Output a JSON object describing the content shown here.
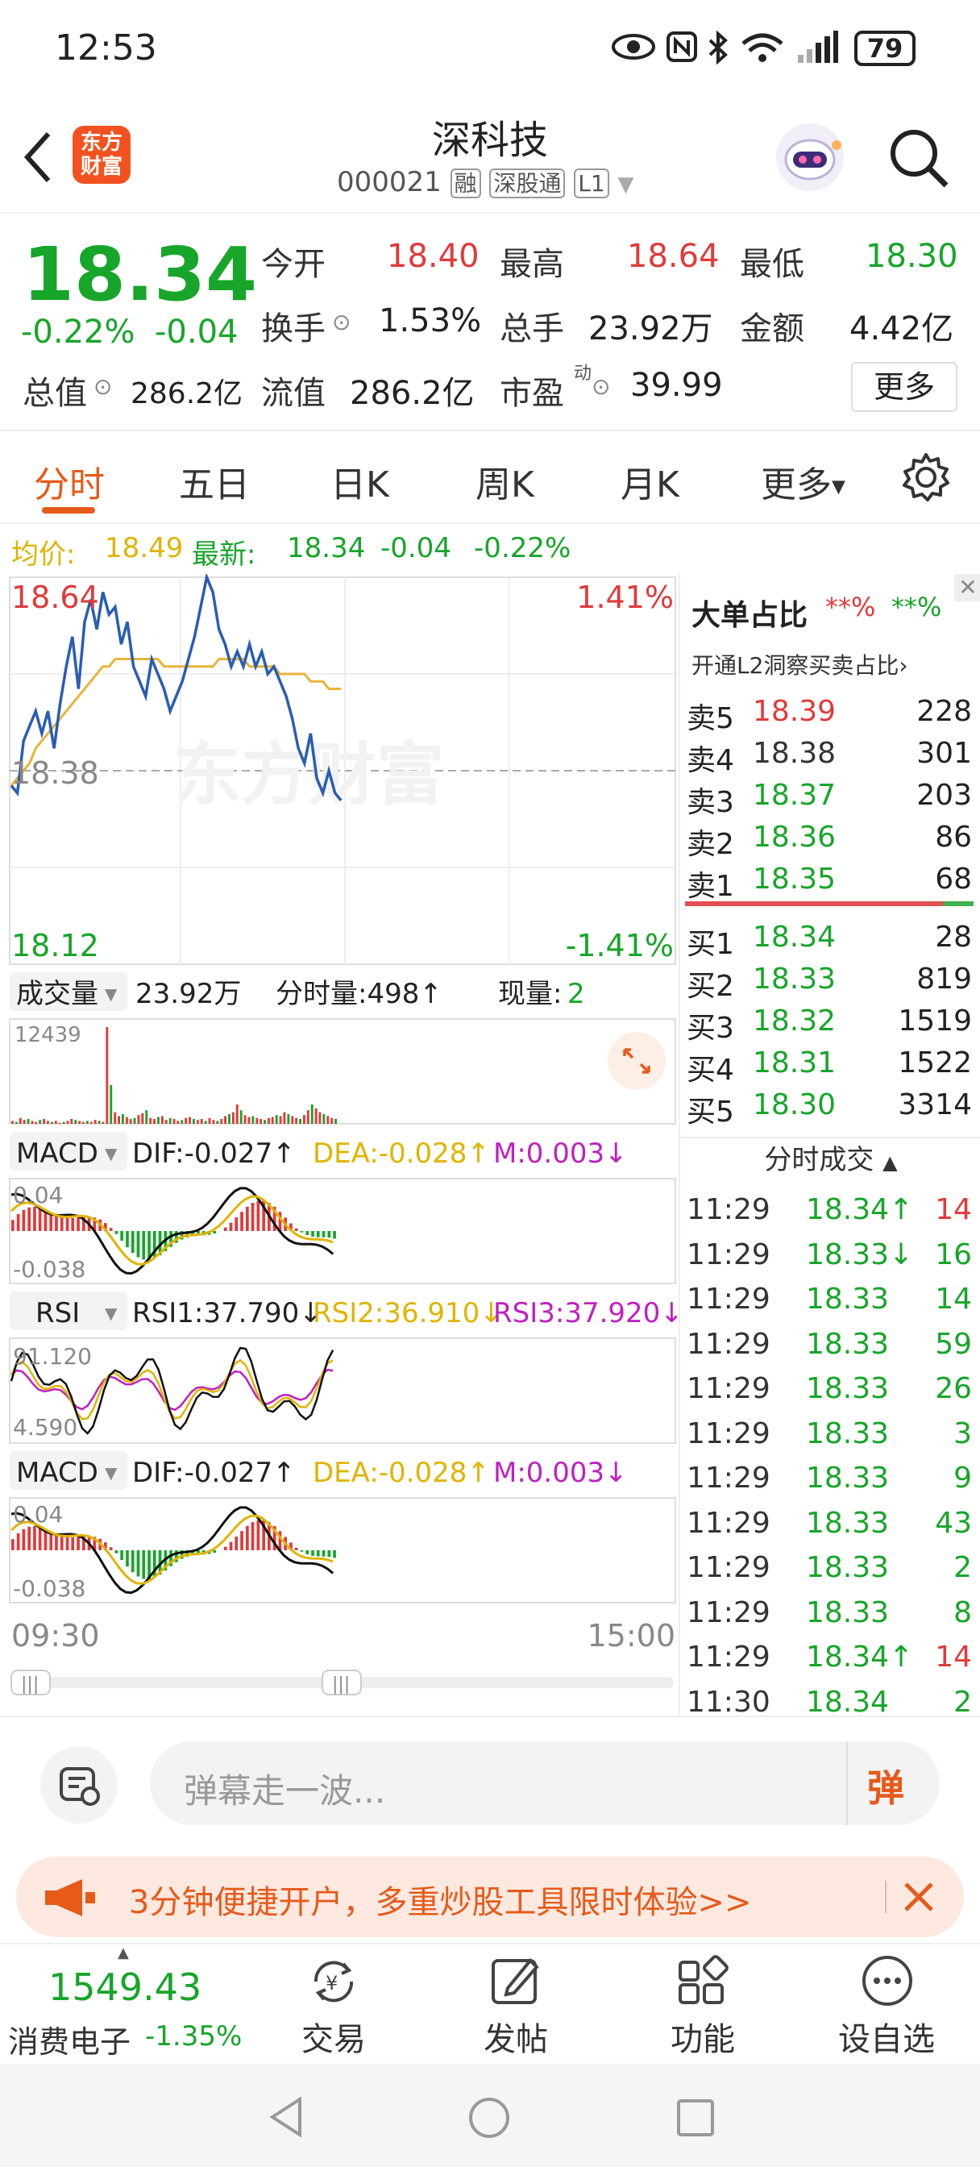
{
  "status_bar": {
    "time": "12:53",
    "battery": "79"
  },
  "header": {
    "logo_text_1": "东方",
    "logo_text_2": "财富",
    "stock_name": "深科技",
    "stock_code": "000021",
    "tag_margin": "融",
    "tag_connect": "深股通",
    "tag_level": "L1"
  },
  "quote": {
    "price": "18.34",
    "change_pct": "-0.22%",
    "change": "-0.04",
    "open_label": "今开",
    "open": "18.40",
    "high_label": "最高",
    "high": "18.64",
    "low_label": "最低",
    "low": "18.30",
    "turnover_label": "换手",
    "turnover": "1.53%",
    "volume_label": "总手",
    "volume": "23.92万",
    "amount_label": "金额",
    "amount": "4.42亿",
    "mktcap_label": "总值",
    "mktcap": "286.2亿",
    "float_label": "流值",
    "float_cap": "286.2亿",
    "pe_label": "市盈",
    "pe_sup": "动",
    "pe": "39.99",
    "more_button": "更多"
  },
  "tabs": [
    "分时",
    "五日",
    "日K",
    "周K",
    "月K",
    "更多"
  ],
  "avg_bar": {
    "avg_label": "均价:",
    "avg": "18.49",
    "latest_label": "最新:",
    "latest": "18.34",
    "chg": "-0.04",
    "chg_pct": "-0.22%"
  },
  "chart_data": {
    "type": "line",
    "title": "",
    "y_top": "18.64",
    "y_mid": "18.38",
    "y_bottom": "18.12",
    "pct_top": "1.41%",
    "pct_bottom": "-1.41%",
    "ylim": [
      18.12,
      18.64
    ],
    "reference": 18.38,
    "watermark": "东方财富",
    "x_start": "09:30",
    "x_end": "15:00",
    "series": [
      {
        "values": [
          18.36,
          18.35,
          18.42,
          18.44,
          18.46,
          18.43,
          18.46,
          18.41,
          18.47,
          18.52,
          18.56,
          18.49,
          18.58,
          18.61,
          18.57,
          18.62,
          18.59,
          18.6,
          18.55,
          18.58,
          18.52,
          18.5,
          18.48,
          18.53,
          18.51,
          18.49,
          18.46,
          18.48,
          18.5,
          18.53,
          18.56,
          18.6,
          18.64,
          18.62,
          18.57,
          18.55,
          18.52,
          18.54,
          18.52,
          18.55,
          18.52,
          18.54,
          18.51,
          18.52,
          18.5,
          18.48,
          18.45,
          18.41,
          18.39,
          18.43,
          18.37,
          18.35,
          18.38,
          18.35,
          18.34
        ]
      },
      {
        "values": [
          18.36,
          18.37,
          18.38,
          18.39,
          18.41,
          18.42,
          18.43,
          18.44,
          18.45,
          18.46,
          18.47,
          18.48,
          18.49,
          18.5,
          18.51,
          18.52,
          18.52,
          18.53,
          18.53,
          18.53,
          18.53,
          18.53,
          18.53,
          18.53,
          18.53,
          18.52,
          18.52,
          18.52,
          18.52,
          18.52,
          18.52,
          18.52,
          18.52,
          18.52,
          18.53,
          18.53,
          18.53,
          18.53,
          18.53,
          18.52,
          18.52,
          18.52,
          18.52,
          18.52,
          18.51,
          18.51,
          18.51,
          18.51,
          18.51,
          18.5,
          18.5,
          18.5,
          18.49,
          18.49,
          18.49
        ]
      }
    ]
  },
  "volume_panel": {
    "label": "成交量",
    "total": "23.92万",
    "minute_vol": "分时量:498↑",
    "current_label": "现量:",
    "current": "2",
    "max_label": "12439",
    "bars": [
      3,
      2,
      6,
      4,
      5,
      3,
      2,
      4,
      5,
      3,
      2,
      3,
      1,
      2,
      3,
      5,
      4,
      3,
      2,
      3,
      2,
      4,
      3,
      2,
      100,
      40,
      12,
      8,
      10,
      7,
      5,
      6,
      9,
      11,
      14,
      6,
      5,
      7,
      8,
      4,
      6,
      5,
      3,
      4,
      6,
      7,
      5,
      4,
      5,
      3,
      6,
      4,
      3,
      5,
      8,
      10,
      12,
      20,
      14,
      9,
      7,
      8,
      6,
      5,
      4,
      6,
      7,
      9,
      8,
      12,
      10,
      8,
      6,
      5,
      9,
      14,
      20,
      16,
      12,
      10,
      8,
      6,
      5
    ]
  },
  "macd1": {
    "label": "MACD",
    "dif": "DIF:-0.027↑",
    "dea": "DEA:-0.028↑",
    "m": "M:0.003↓",
    "top": "0.04",
    "bottom": "-0.038"
  },
  "rsi": {
    "label": "RSI",
    "rsi1": "RSI1:37.790↓",
    "rsi2": "RSI2:36.910↓",
    "rsi3": "RSI3:37.920↓",
    "top": "91.120",
    "bottom": "4.590"
  },
  "macd2": {
    "label": "MACD",
    "dif": "DIF:-0.027↑",
    "dea": "DEA:-0.028↑",
    "m": "M:0.003↓",
    "top": "0.04",
    "bottom": "-0.038"
  },
  "order_book": {
    "title": "大单占比",
    "red_pct": "**%",
    "green_pct": "**%",
    "l2_link": "开通L2洞察买卖占比",
    "asks": [
      {
        "label": "卖5",
        "price": "18.39",
        "vol": "228"
      },
      {
        "label": "卖4",
        "price": "18.38",
        "vol": "301"
      },
      {
        "label": "卖3",
        "price": "18.37",
        "vol": "203"
      },
      {
        "label": "卖2",
        "price": "18.36",
        "vol": "86"
      },
      {
        "label": "卖1",
        "price": "18.35",
        "vol": "68"
      }
    ],
    "bids": [
      {
        "label": "买1",
        "price": "18.34",
        "vol": "28"
      },
      {
        "label": "买2",
        "price": "18.33",
        "vol": "819"
      },
      {
        "label": "买3",
        "price": "18.32",
        "vol": "1519"
      },
      {
        "label": "买4",
        "price": "18.31",
        "vol": "1522"
      },
      {
        "label": "买5",
        "price": "18.30",
        "vol": "3314"
      }
    ]
  },
  "trades": {
    "title": "分时成交",
    "rows": [
      {
        "time": "11:29",
        "price": "18.34↑",
        "vol": "14"
      },
      {
        "time": "11:29",
        "price": "18.33↓",
        "vol": "16"
      },
      {
        "time": "11:29",
        "price": "18.33",
        "vol": "14"
      },
      {
        "time": "11:29",
        "price": "18.33",
        "vol": "59"
      },
      {
        "time": "11:29",
        "price": "18.33",
        "vol": "26"
      },
      {
        "time": "11:29",
        "price": "18.33",
        "vol": "3"
      },
      {
        "time": "11:29",
        "price": "18.33",
        "vol": "9"
      },
      {
        "time": "11:29",
        "price": "18.33",
        "vol": "43"
      },
      {
        "time": "11:29",
        "price": "18.33",
        "vol": "2"
      },
      {
        "time": "11:29",
        "price": "18.33",
        "vol": "8"
      },
      {
        "time": "11:29",
        "price": "18.34↑",
        "vol": "14"
      },
      {
        "time": "11:30",
        "price": "18.34",
        "vol": "2"
      }
    ]
  },
  "danmu": {
    "placeholder": "弹幕走一波...",
    "send": "弹"
  },
  "banner": {
    "text": "3分钟便捷开户，多重炒股工具限时体验>>"
  },
  "bottom_nav": {
    "index_value": "1549.43",
    "index_name": "消费电子",
    "index_change": "-1.35%",
    "trade": "交易",
    "post": "发帖",
    "func": "功能",
    "watch": "设自选"
  }
}
